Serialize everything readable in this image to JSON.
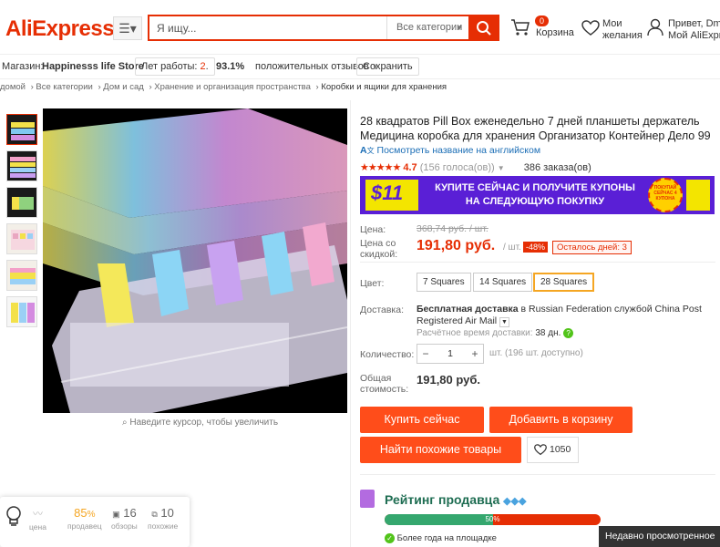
{
  "header": {
    "logo": "AliExpress",
    "search_placeholder": "Я ищу...",
    "search_category": "Все категории",
    "cart_count": "0",
    "cart_label": "Корзина",
    "wishlist_line1": "Мои",
    "wishlist_line2": "желания",
    "user_line1": "Привет, Dmitr",
    "user_line2": "Мой AliExpress"
  },
  "store": {
    "label": "Магазин:",
    "name": "Happinesss life Store",
    "years_label": "Лет работы:",
    "years_value": "2",
    "positive_pct": "93.1%",
    "positive_label": "положительных отзывов",
    "save_button": "Сохранить"
  },
  "breadcrumbs": [
    "домой",
    "Все категории",
    "Дом и сад",
    "Хранение и организация пространства",
    "Коробки и ящики для хранения"
  ],
  "gallery": {
    "zoom_hint": "Наведите курсор, чтобы увеличить"
  },
  "product": {
    "title": "28 квадратов Pill Box еженедельно 7 дней планшеты держатель Медицина коробка для хранения Организатор Контейнер Дело 99",
    "translate_link": "Посмотреть название на английском",
    "rating_value": "4.7",
    "votes": "(156 голоса(ов))",
    "orders": "386 заказа(ов)",
    "banner": {
      "amount": "$11",
      "text_line1": "КУПИТЕ СЕЙЧАС И ПОЛУЧИТЕ КУПОНЫ",
      "text_line2": "НА СЛЕДУЮЩУЮ ПОКУПКУ",
      "badge_text": "ПОКУПАЙ СЕЙЧАС 4 КУПОНА"
    },
    "price_label": "Цена:",
    "old_price": "368,74 руб. / шт.",
    "discount_price_label_1": "Цена со",
    "discount_price_label_2": "скидкой:",
    "new_price": "191,80 руб.",
    "per_unit": "/ шт.",
    "discount": "-48%",
    "days_left": "Осталось дней: 3",
    "color_label": "Цвет:",
    "options": [
      "7 Squares",
      "14 Squares",
      "28 Squares"
    ],
    "selected_option": 2,
    "delivery_label": "Доставка:",
    "delivery_bold": "Бесплатная доставка",
    "delivery_rest": "в Russian Federation службой China Post Registered Air Mail",
    "delivery_time_label": "Расчётное время доставки:",
    "delivery_time_value": "38 дн.",
    "qty_label": "Количество:",
    "qty_value": "1",
    "qty_note": "шт. (196 шт. доступно)",
    "total_label_1": "Общая",
    "total_label_2": "стоимость:",
    "total": "191,80 руб.",
    "buy_now": "Купить сейчас",
    "add_to_cart": "Добавить в корзину",
    "similar": "Найти похожие товары",
    "likes": "1050"
  },
  "seller": {
    "title": "Рейтинг продавца",
    "bar_percent": "50%",
    "bar_fraction": 0.5,
    "note": "Более года на площадке"
  },
  "recently_viewed": "Недавно просмотренное",
  "widget": {
    "price_label": "цена",
    "seller_value": "85",
    "seller_unit": "%",
    "seller_label": "продавец",
    "reviews_value": "16",
    "reviews_label": "обзоры",
    "similar_value": "10",
    "similar_label": "похожие"
  },
  "colors": {
    "accent": "#e62e04",
    "button": "#ff4d1a",
    "banner": "#5a1fd6",
    "seller_green": "#35a76e"
  }
}
